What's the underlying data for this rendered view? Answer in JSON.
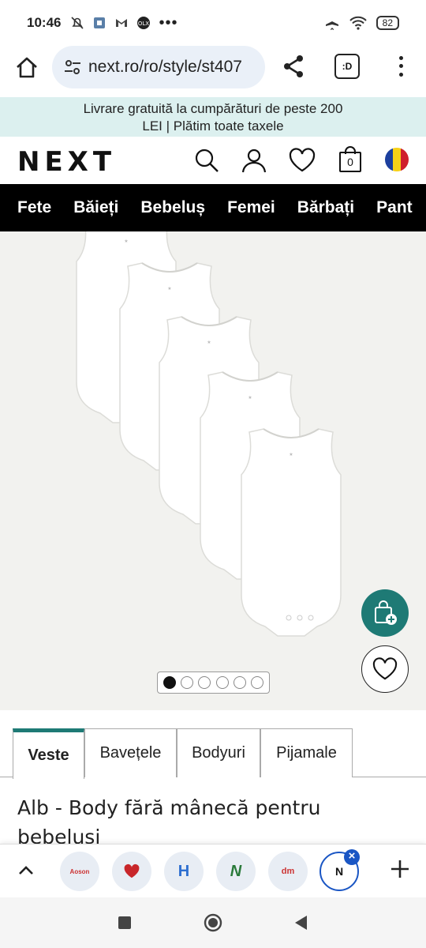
{
  "status_bar": {
    "time": "10:46",
    "battery": "82"
  },
  "browser": {
    "url": "next.ro/ro/style/st407",
    "tab_label": ":D"
  },
  "promo": {
    "line1": "Livrare gratuită la cumpărături de peste 200",
    "line2": "LEI | Plătim toate taxele"
  },
  "header": {
    "logo": "NEXT",
    "bag_count": "0"
  },
  "categories": [
    "Fete",
    "Băieți",
    "Bebeluș",
    "Femei",
    "Bărbați",
    "Pant"
  ],
  "gallery": {
    "total_images": 6,
    "active_index": 0
  },
  "product_tabs": [
    "Veste",
    "Bavețele",
    "Bodyuri",
    "Pijamale"
  ],
  "product": {
    "title": "Alb - Body fără mânecă pentru bebelusi"
  },
  "tab_strip": {
    "tabs": [
      {
        "label": "Aoson"
      },
      {
        "label": ""
      },
      {
        "label": "H"
      },
      {
        "label": "N"
      },
      {
        "label": "dm"
      },
      {
        "label": "N"
      }
    ]
  },
  "colors": {
    "accent": "#1e7a75",
    "promo_bg": "#dcf0ef",
    "nav_bg": "#000000",
    "tab_blue": "#1a56c4"
  }
}
